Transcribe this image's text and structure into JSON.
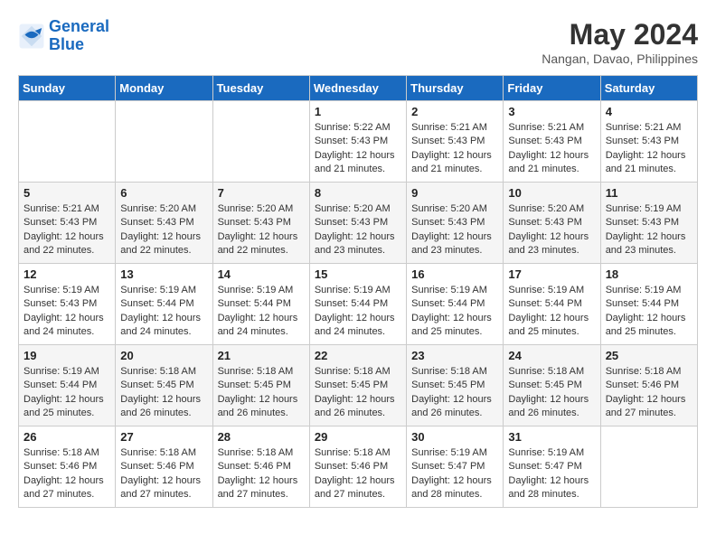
{
  "logo": {
    "line1": "General",
    "line2": "Blue"
  },
  "title": "May 2024",
  "location": "Nangan, Davao, Philippines",
  "days_header": [
    "Sunday",
    "Monday",
    "Tuesday",
    "Wednesday",
    "Thursday",
    "Friday",
    "Saturday"
  ],
  "weeks": [
    [
      {
        "day": "",
        "sunrise": "",
        "sunset": "",
        "daylight": ""
      },
      {
        "day": "",
        "sunrise": "",
        "sunset": "",
        "daylight": ""
      },
      {
        "day": "",
        "sunrise": "",
        "sunset": "",
        "daylight": ""
      },
      {
        "day": "1",
        "sunrise": "Sunrise: 5:22 AM",
        "sunset": "Sunset: 5:43 PM",
        "daylight": "Daylight: 12 hours and 21 minutes."
      },
      {
        "day": "2",
        "sunrise": "Sunrise: 5:21 AM",
        "sunset": "Sunset: 5:43 PM",
        "daylight": "Daylight: 12 hours and 21 minutes."
      },
      {
        "day": "3",
        "sunrise": "Sunrise: 5:21 AM",
        "sunset": "Sunset: 5:43 PM",
        "daylight": "Daylight: 12 hours and 21 minutes."
      },
      {
        "day": "4",
        "sunrise": "Sunrise: 5:21 AM",
        "sunset": "Sunset: 5:43 PM",
        "daylight": "Daylight: 12 hours and 21 minutes."
      }
    ],
    [
      {
        "day": "5",
        "sunrise": "Sunrise: 5:21 AM",
        "sunset": "Sunset: 5:43 PM",
        "daylight": "Daylight: 12 hours and 22 minutes."
      },
      {
        "day": "6",
        "sunrise": "Sunrise: 5:20 AM",
        "sunset": "Sunset: 5:43 PM",
        "daylight": "Daylight: 12 hours and 22 minutes."
      },
      {
        "day": "7",
        "sunrise": "Sunrise: 5:20 AM",
        "sunset": "Sunset: 5:43 PM",
        "daylight": "Daylight: 12 hours and 22 minutes."
      },
      {
        "day": "8",
        "sunrise": "Sunrise: 5:20 AM",
        "sunset": "Sunset: 5:43 PM",
        "daylight": "Daylight: 12 hours and 23 minutes."
      },
      {
        "day": "9",
        "sunrise": "Sunrise: 5:20 AM",
        "sunset": "Sunset: 5:43 PM",
        "daylight": "Daylight: 12 hours and 23 minutes."
      },
      {
        "day": "10",
        "sunrise": "Sunrise: 5:20 AM",
        "sunset": "Sunset: 5:43 PM",
        "daylight": "Daylight: 12 hours and 23 minutes."
      },
      {
        "day": "11",
        "sunrise": "Sunrise: 5:19 AM",
        "sunset": "Sunset: 5:43 PM",
        "daylight": "Daylight: 12 hours and 23 minutes."
      }
    ],
    [
      {
        "day": "12",
        "sunrise": "Sunrise: 5:19 AM",
        "sunset": "Sunset: 5:43 PM",
        "daylight": "Daylight: 12 hours and 24 minutes."
      },
      {
        "day": "13",
        "sunrise": "Sunrise: 5:19 AM",
        "sunset": "Sunset: 5:44 PM",
        "daylight": "Daylight: 12 hours and 24 minutes."
      },
      {
        "day": "14",
        "sunrise": "Sunrise: 5:19 AM",
        "sunset": "Sunset: 5:44 PM",
        "daylight": "Daylight: 12 hours and 24 minutes."
      },
      {
        "day": "15",
        "sunrise": "Sunrise: 5:19 AM",
        "sunset": "Sunset: 5:44 PM",
        "daylight": "Daylight: 12 hours and 24 minutes."
      },
      {
        "day": "16",
        "sunrise": "Sunrise: 5:19 AM",
        "sunset": "Sunset: 5:44 PM",
        "daylight": "Daylight: 12 hours and 25 minutes."
      },
      {
        "day": "17",
        "sunrise": "Sunrise: 5:19 AM",
        "sunset": "Sunset: 5:44 PM",
        "daylight": "Daylight: 12 hours and 25 minutes."
      },
      {
        "day": "18",
        "sunrise": "Sunrise: 5:19 AM",
        "sunset": "Sunset: 5:44 PM",
        "daylight": "Daylight: 12 hours and 25 minutes."
      }
    ],
    [
      {
        "day": "19",
        "sunrise": "Sunrise: 5:19 AM",
        "sunset": "Sunset: 5:44 PM",
        "daylight": "Daylight: 12 hours and 25 minutes."
      },
      {
        "day": "20",
        "sunrise": "Sunrise: 5:18 AM",
        "sunset": "Sunset: 5:45 PM",
        "daylight": "Daylight: 12 hours and 26 minutes."
      },
      {
        "day": "21",
        "sunrise": "Sunrise: 5:18 AM",
        "sunset": "Sunset: 5:45 PM",
        "daylight": "Daylight: 12 hours and 26 minutes."
      },
      {
        "day": "22",
        "sunrise": "Sunrise: 5:18 AM",
        "sunset": "Sunset: 5:45 PM",
        "daylight": "Daylight: 12 hours and 26 minutes."
      },
      {
        "day": "23",
        "sunrise": "Sunrise: 5:18 AM",
        "sunset": "Sunset: 5:45 PM",
        "daylight": "Daylight: 12 hours and 26 minutes."
      },
      {
        "day": "24",
        "sunrise": "Sunrise: 5:18 AM",
        "sunset": "Sunset: 5:45 PM",
        "daylight": "Daylight: 12 hours and 26 minutes."
      },
      {
        "day": "25",
        "sunrise": "Sunrise: 5:18 AM",
        "sunset": "Sunset: 5:46 PM",
        "daylight": "Daylight: 12 hours and 27 minutes."
      }
    ],
    [
      {
        "day": "26",
        "sunrise": "Sunrise: 5:18 AM",
        "sunset": "Sunset: 5:46 PM",
        "daylight": "Daylight: 12 hours and 27 minutes."
      },
      {
        "day": "27",
        "sunrise": "Sunrise: 5:18 AM",
        "sunset": "Sunset: 5:46 PM",
        "daylight": "Daylight: 12 hours and 27 minutes."
      },
      {
        "day": "28",
        "sunrise": "Sunrise: 5:18 AM",
        "sunset": "Sunset: 5:46 PM",
        "daylight": "Daylight: 12 hours and 27 minutes."
      },
      {
        "day": "29",
        "sunrise": "Sunrise: 5:18 AM",
        "sunset": "Sunset: 5:46 PM",
        "daylight": "Daylight: 12 hours and 27 minutes."
      },
      {
        "day": "30",
        "sunrise": "Sunrise: 5:19 AM",
        "sunset": "Sunset: 5:47 PM",
        "daylight": "Daylight: 12 hours and 28 minutes."
      },
      {
        "day": "31",
        "sunrise": "Sunrise: 5:19 AM",
        "sunset": "Sunset: 5:47 PM",
        "daylight": "Daylight: 12 hours and 28 minutes."
      },
      {
        "day": "",
        "sunrise": "",
        "sunset": "",
        "daylight": ""
      }
    ]
  ]
}
